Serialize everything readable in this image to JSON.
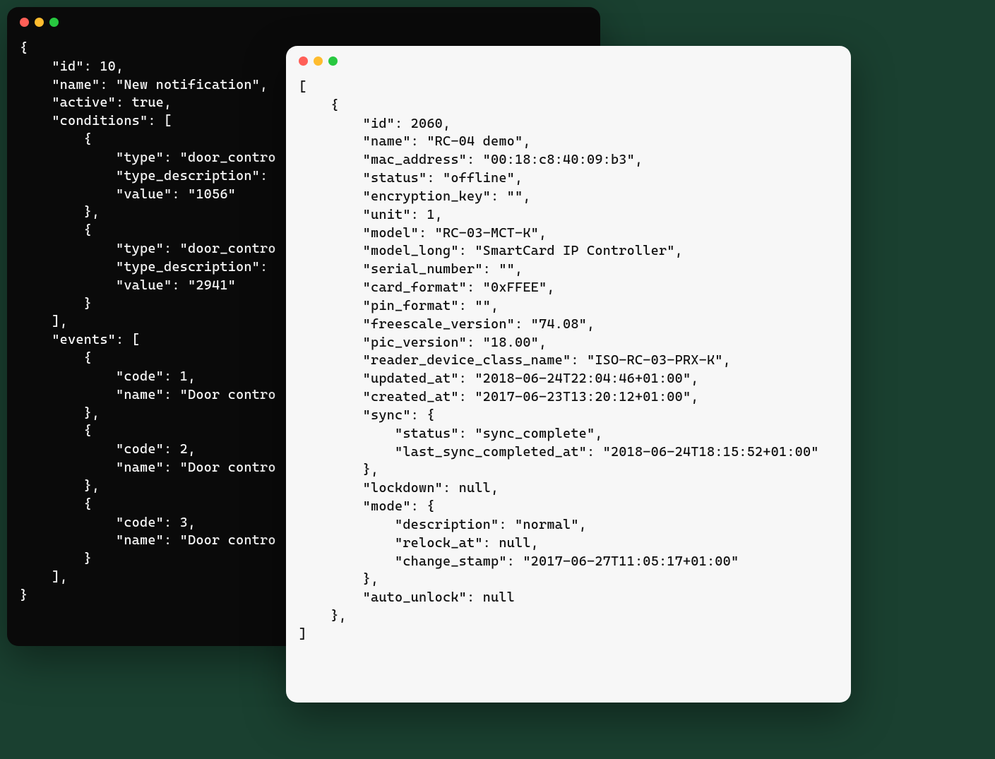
{
  "dark_window": {
    "lines": [
      "{",
      "    \"id\": 10,",
      "    \"name\": \"New notification\",",
      "    \"active\": true,",
      "    \"conditions\": [",
      "        {",
      "            \"type\": \"door_contro",
      "            \"type_description\":",
      "            \"value\": \"1056\"",
      "        },",
      "        {",
      "            \"type\": \"door_contro",
      "            \"type_description\":",
      "            \"value\": \"2941\"",
      "        }",
      "    ],",
      "    \"events\": [",
      "        {",
      "            \"code\": 1,",
      "            \"name\": \"Door contro",
      "        },",
      "        {",
      "            \"code\": 2,",
      "            \"name\": \"Door contro",
      "        },",
      "        {",
      "            \"code\": 3,",
      "            \"name\": \"Door contro",
      "        }",
      "    ],",
      "}"
    ]
  },
  "light_window": {
    "lines": [
      "[",
      "    {",
      "        \"id\": 2060,",
      "        \"name\": \"RC-04 demo\",",
      "        \"mac_address\": \"00:18:c8:40:09:b3\",",
      "        \"status\": \"offline\",",
      "        \"encryption_key\": \"\",",
      "        \"unit\": 1,",
      "        \"model\": \"RC-03-MCT-K\",",
      "        \"model_long\": \"SmartCard IP Controller\",",
      "        \"serial_number\": \"\",",
      "        \"card_format\": \"0xFFEE\",",
      "        \"pin_format\": \"\",",
      "        \"freescale_version\": \"74.08\",",
      "        \"pic_version\": \"18.00\",",
      "        \"reader_device_class_name\": \"ISO-RC-03-PRX-K\",",
      "        \"updated_at\": \"2018-06-24T22:04:46+01:00\",",
      "        \"created_at\": \"2017-06-23T13:20:12+01:00\",",
      "        \"sync\": {",
      "            \"status\": \"sync_complete\",",
      "            \"last_sync_completed_at\": \"2018-06-24T18:15:52+01:00\"",
      "        },",
      "        \"lockdown\": null,",
      "        \"mode\": {",
      "            \"description\": \"normal\",",
      "            \"relock_at\": null,",
      "            \"change_stamp\": \"2017-06-27T11:05:17+01:00\"",
      "        },",
      "        \"auto_unlock\": null",
      "    },",
      "]"
    ]
  }
}
